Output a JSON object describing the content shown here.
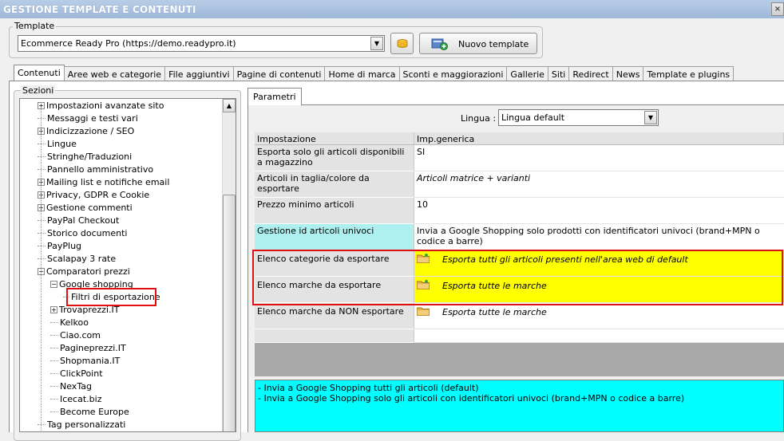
{
  "window": {
    "title": "GESTIONE TEMPLATE E CONTENUTI",
    "close_symbol": "×"
  },
  "template_group": {
    "legend": "Template",
    "selected": "Ecommerce Ready Pro (https://demo.readypro.it)",
    "new_button_label": "Nuovo template"
  },
  "tabs": [
    {
      "label": "Contenuti",
      "active": true
    },
    {
      "label": "Aree web e categorie"
    },
    {
      "label": "File aggiuntivi"
    },
    {
      "label": "Pagine di contenuti"
    },
    {
      "label": "Home di marca"
    },
    {
      "label": "Sconti e maggiorazioni"
    },
    {
      "label": "Gallerie"
    },
    {
      "label": "Siti"
    },
    {
      "label": "Redirect"
    },
    {
      "label": "News"
    },
    {
      "label": "Template e plugins"
    }
  ],
  "sections": {
    "legend": "Sezioni",
    "items": [
      {
        "label": "Impostazioni avanzate sito",
        "expander": "+"
      },
      {
        "label": "Messaggi e testi vari"
      },
      {
        "label": "Indicizzazione / SEO",
        "expander": "+"
      },
      {
        "label": "Lingue"
      },
      {
        "label": "Stringhe/Traduzioni"
      },
      {
        "label": "Pannello amministrativo"
      },
      {
        "label": "Mailing list e notifiche email",
        "expander": "+"
      },
      {
        "label": "Privacy, GDPR e Cookie",
        "expander": "+"
      },
      {
        "label": "Gestione commenti",
        "expander": "+"
      },
      {
        "label": "PayPal Checkout"
      },
      {
        "label": "Storico documenti"
      },
      {
        "label": "PayPlug"
      },
      {
        "label": "Scalapay 3 rate"
      },
      {
        "label": "Comparatori prezzi",
        "expander": "−"
      },
      {
        "label": "Google shopping",
        "expander": "−"
      },
      {
        "label": "Filtri di esportazione"
      },
      {
        "label": "Trovaprezzi.IT",
        "expander": "+"
      },
      {
        "label": "Kelkoo"
      },
      {
        "label": "Ciao.com"
      },
      {
        "label": "Pagineprezzi.IT"
      },
      {
        "label": "Shopmania.IT"
      },
      {
        "label": "ClickPoint"
      },
      {
        "label": "NexTag"
      },
      {
        "label": "Icecat.biz"
      },
      {
        "label": "Become Europe"
      },
      {
        "label": "Tag personalizzati"
      }
    ]
  },
  "params": {
    "tab_label": "Parametri",
    "lingua_label": "Lingua :",
    "lingua_value": "Lingua default",
    "col_setting": "Impostazione",
    "col_value": "Imp.generica",
    "rows": [
      {
        "name": "Esporta solo gli articoli disponibili a magazzino",
        "value": "SI"
      },
      {
        "name": "Articoli in taglia/colore da esportare",
        "value": "Articoli matrice + varianti"
      },
      {
        "name": "Prezzo minimo articoli",
        "value": "10"
      },
      {
        "name": "Gestione id articoli univoci",
        "value": "Invia a Google Shopping solo prodotti con identificatori univoci (brand+MPN o codice a barre)"
      },
      {
        "name": "Elenco categorie da esportare",
        "value": "Esporta tutti gli articoli presenti nell'area web di default"
      },
      {
        "name": "Elenco marche da esportare",
        "value": "Esporta tutte le marche"
      },
      {
        "name": "Elenco marche da NON esportare",
        "value": "Esporta tutte le marche"
      }
    ],
    "description_lines": [
      "- Invia a Google Shopping tutti gli articoli (default)",
      "- Invia a Google Shopping solo gli articoli con identificatori univoci (brand+MPN o codice a barre)"
    ]
  },
  "colors": {
    "highlight_yellow": "#ffff00",
    "selected_row_cyan": "#aef0f0",
    "description_cyan": "#00ffff",
    "annotation_red": "#e01010"
  }
}
